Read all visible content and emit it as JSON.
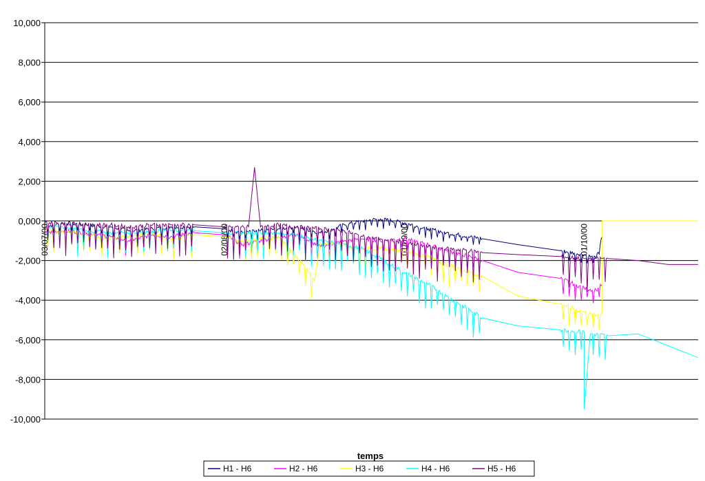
{
  "chart_data": {
    "type": "line",
    "title": "",
    "xlabel": "temps",
    "ylabel": "",
    "ylim": [
      -10,
      10
    ],
    "ytick_values": [
      10,
      8,
      6,
      4,
      2,
      0,
      -2,
      -4,
      -6,
      -8,
      -10
    ],
    "ytick_labels": [
      "10,000",
      "8,000",
      "6,000",
      "4,000",
      "2,000",
      "0,000",
      "-2,000",
      "-4,000",
      "-6,000",
      "-8,000",
      "-10,000"
    ],
    "x_date_ticks": [
      {
        "date": "2000-07-03",
        "label": "03/07/00"
      },
      {
        "date": "2000-08-02",
        "label": "02/08/00"
      },
      {
        "date": "2000-09-01",
        "label": "01/09/00"
      },
      {
        "date": "2000-10-01",
        "label": "01/10/00"
      }
    ],
    "xlim": [
      "2000-07-03",
      "2000-10-20"
    ],
    "grid": "horizontal",
    "legend_position": "bottom",
    "series": [
      {
        "name": "H1 - H6",
        "color": "#000080",
        "x": [
          "2000-07-03",
          "2000-07-06",
          "2000-07-10",
          "2000-07-14",
          "2000-07-17",
          "2000-07-21",
          "2000-07-24",
          "2000-07-28",
          "2000-08-02",
          "2000-08-05",
          "2000-08-08",
          "2000-08-11",
          "2000-08-14",
          "2000-08-18",
          "2000-08-22",
          "2000-08-25",
          "2000-08-28",
          "2000-09-01",
          "2000-09-05",
          "2000-09-08",
          "2000-09-12",
          "2000-09-14",
          "2000-09-20",
          "2000-09-27",
          "2000-10-01",
          "2000-10-03",
          "2000-10-04"
        ],
        "y": [
          -0.3,
          -0.1,
          -0.2,
          -0.3,
          -0.5,
          -0.4,
          -0.3,
          -0.3,
          -0.4,
          -0.6,
          -0.5,
          -0.4,
          -0.3,
          -0.6,
          -0.2,
          0.0,
          0.1,
          -0.1,
          -0.4,
          -0.6,
          -0.8,
          -0.9,
          -1.2,
          -1.5,
          -1.7,
          -1.9,
          -0.8
        ]
      },
      {
        "name": "H2 - H6",
        "color": "#ff00ff",
        "x": [
          "2000-07-03",
          "2000-07-06",
          "2000-07-10",
          "2000-07-14",
          "2000-07-17",
          "2000-07-21",
          "2000-07-24",
          "2000-07-28",
          "2000-08-02",
          "2000-08-05",
          "2000-08-08",
          "2000-08-11",
          "2000-08-14",
          "2000-08-18",
          "2000-08-22",
          "2000-08-25",
          "2000-08-28",
          "2000-09-01",
          "2000-09-05",
          "2000-09-08",
          "2000-09-12",
          "2000-09-14",
          "2000-09-20",
          "2000-09-27",
          "2000-10-01",
          "2000-10-03",
          "2000-10-04"
        ],
        "y": [
          -0.6,
          -0.5,
          -0.6,
          -0.8,
          -1.0,
          -0.7,
          -0.8,
          -0.6,
          -0.7,
          -1.2,
          -1.0,
          -0.8,
          -0.7,
          -1.3,
          -1.0,
          -0.9,
          -1.0,
          -0.9,
          -1.2,
          -1.5,
          -1.8,
          -2.0,
          -2.6,
          -2.9,
          -3.4,
          -3.5,
          -3.2
        ]
      },
      {
        "name": "H3 - H6",
        "color": "#ffff00",
        "x": [
          "2000-07-03",
          "2000-07-06",
          "2000-07-10",
          "2000-07-14",
          "2000-07-17",
          "2000-07-21",
          "2000-07-24",
          "2000-07-28",
          "2000-08-02",
          "2000-08-05",
          "2000-08-08",
          "2000-08-11",
          "2000-08-14",
          "2000-08-17",
          "2000-08-18",
          "2000-08-22",
          "2000-08-25",
          "2000-08-28",
          "2000-09-01",
          "2000-09-05",
          "2000-09-08",
          "2000-09-12",
          "2000-09-14",
          "2000-09-20",
          "2000-09-27",
          "2000-10-01",
          "2000-10-03",
          "2000-10-04",
          "2000-10-04",
          "2000-10-20"
        ],
        "y": [
          -0.5,
          -0.5,
          -0.7,
          -0.9,
          -0.8,
          -0.6,
          -0.9,
          -0.7,
          -0.8,
          -1.0,
          -0.9,
          -0.8,
          -1.8,
          -3.0,
          -1.1,
          -1.2,
          -1.4,
          -1.4,
          -1.5,
          -1.8,
          -2.2,
          -2.6,
          -2.8,
          -3.8,
          -4.2,
          -4.6,
          -4.8,
          -4.6,
          0.0,
          0.0
        ]
      },
      {
        "name": "H4 - H6",
        "color": "#00ffff",
        "x": [
          "2000-07-03",
          "2000-07-06",
          "2000-07-10",
          "2000-07-14",
          "2000-07-17",
          "2000-07-21",
          "2000-07-24",
          "2000-07-28",
          "2000-08-02",
          "2000-08-05",
          "2000-08-08",
          "2000-08-11",
          "2000-08-14",
          "2000-08-18",
          "2000-08-22",
          "2000-08-25",
          "2000-08-28",
          "2000-09-01",
          "2000-09-05",
          "2000-09-08",
          "2000-09-12",
          "2000-09-14",
          "2000-09-20",
          "2000-09-27",
          "2000-10-01",
          "2000-10-01",
          "2000-10-02",
          "2000-10-05",
          "2000-10-10",
          "2000-10-15",
          "2000-10-20"
        ],
        "y": [
          -0.3,
          -0.3,
          -0.5,
          -0.6,
          -0.6,
          -0.5,
          -0.5,
          -0.5,
          -0.6,
          -0.6,
          -0.6,
          -0.6,
          -0.7,
          -1.0,
          -1.2,
          -1.4,
          -1.9,
          -2.6,
          -3.2,
          -3.8,
          -4.5,
          -4.9,
          -5.3,
          -5.5,
          -5.6,
          -9.5,
          -5.7,
          -5.8,
          -5.7,
          -6.3,
          -6.9
        ]
      },
      {
        "name": "H5 - H6",
        "color": "#800080",
        "x": [
          "2000-07-03",
          "2000-07-06",
          "2000-07-10",
          "2000-07-14",
          "2000-07-17",
          "2000-07-21",
          "2000-07-24",
          "2000-07-28",
          "2000-08-02",
          "2000-08-06",
          "2000-08-07",
          "2000-08-08",
          "2000-08-11",
          "2000-08-14",
          "2000-08-18",
          "2000-08-22",
          "2000-08-25",
          "2000-08-28",
          "2000-09-01",
          "2000-09-05",
          "2000-09-08",
          "2000-09-12",
          "2000-09-14",
          "2000-09-20",
          "2000-09-27",
          "2000-10-01",
          "2000-10-05",
          "2000-10-10",
          "2000-10-15",
          "2000-10-20"
        ],
        "y": [
          -0.1,
          -0.1,
          -0.2,
          -0.2,
          -0.3,
          -0.2,
          -0.2,
          -0.2,
          -0.3,
          -0.3,
          2.7,
          -0.3,
          -0.2,
          -0.3,
          -0.4,
          -0.5,
          -0.8,
          -0.9,
          -1.1,
          -1.3,
          -1.4,
          -1.5,
          -1.6,
          -1.7,
          -1.8,
          -1.9,
          -1.9,
          -2.0,
          -2.2,
          -2.2
        ]
      }
    ]
  }
}
